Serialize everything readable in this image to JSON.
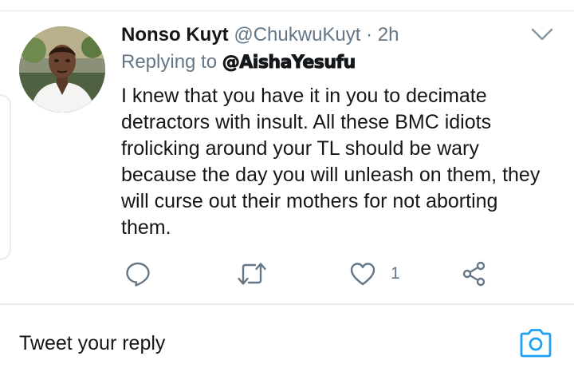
{
  "tweet": {
    "author_name": "Nonso Kuyt",
    "author_handle": "@ChukwuKuyt",
    "separator": "·",
    "time": "2h",
    "replying_prefix": "Replying to",
    "replying_handle": "@AishaYesufu",
    "body_lines": [
      "I knew that you have it in you to decimate",
      "detractors with insult. All these BMC idiots",
      "frolicking around your TL should be wary",
      "because the day you will unleash on them, they",
      "will curse out their mothers for not aborting",
      "them."
    ],
    "like_count": "1"
  },
  "icons": {
    "menu": "chevron-down-icon",
    "reply": "reply-icon",
    "retweet": "retweet-icon",
    "like": "heart-icon",
    "share": "share-icon",
    "camera": "camera-icon"
  },
  "composer": {
    "placeholder": "Tweet your reply"
  },
  "colors": {
    "text": "#14171a",
    "secondary": "#657786",
    "icon": "#657786",
    "accent": "#1da1f2",
    "divider": "#e6ecf0"
  }
}
